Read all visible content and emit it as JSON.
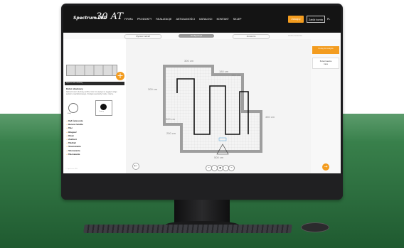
{
  "header": {
    "brand": "Spectrum LED",
    "anniversary": "30 AT",
    "nav": [
      "FIRMA",
      "PRODUKTY",
      "REALIZACJE",
      "AKTUALNOŚCI",
      "KATALOGI",
      "KONTAKT",
      "SKLEP"
    ],
    "primary_button": "Zaloguj",
    "secondary_button": "Załóż konto",
    "language": "PL"
  },
  "steps": [
    "Wybierz kształt",
    "Konfiguracja",
    "Akcesoria",
    "Podsumowanie"
  ],
  "left_panel": {
    "header": "Wybierz kolor obudowy",
    "section_title": "Kolor obudowy",
    "section_desc": "Wybierz kolor obudowy profilu. Kolor ma wpływ na wygląd całego systemu oświetleniowego. Dostępne warianty: biały i czarny.",
    "swatch_a": "Biały",
    "swatch_b": "Czarny",
    "options": [
      "Kąt świecenia",
      "Barwa światła",
      "Moc",
      "Długość",
      "Klosz",
      "Zasilacz",
      "Montaż",
      "Ściemnianie",
      "Sterowanie",
      "Mocowanie"
    ],
    "footnote": "© Spectrum LED"
  },
  "plan": {
    "dims": [
      "300 cm",
      "180 cm",
      "180 cm",
      "300 cm",
      "300 cm",
      "450 cm",
      "250 cm",
      "500 cm"
    ]
  },
  "right_panel": {
    "orange_label": "Dodaj do koszyka",
    "card_title": "Podsumowanie",
    "card_sub": "Cena"
  },
  "colors": {
    "accent": "#f39c1f",
    "nav_bg": "#141414",
    "green_bg": "#2e7040"
  }
}
